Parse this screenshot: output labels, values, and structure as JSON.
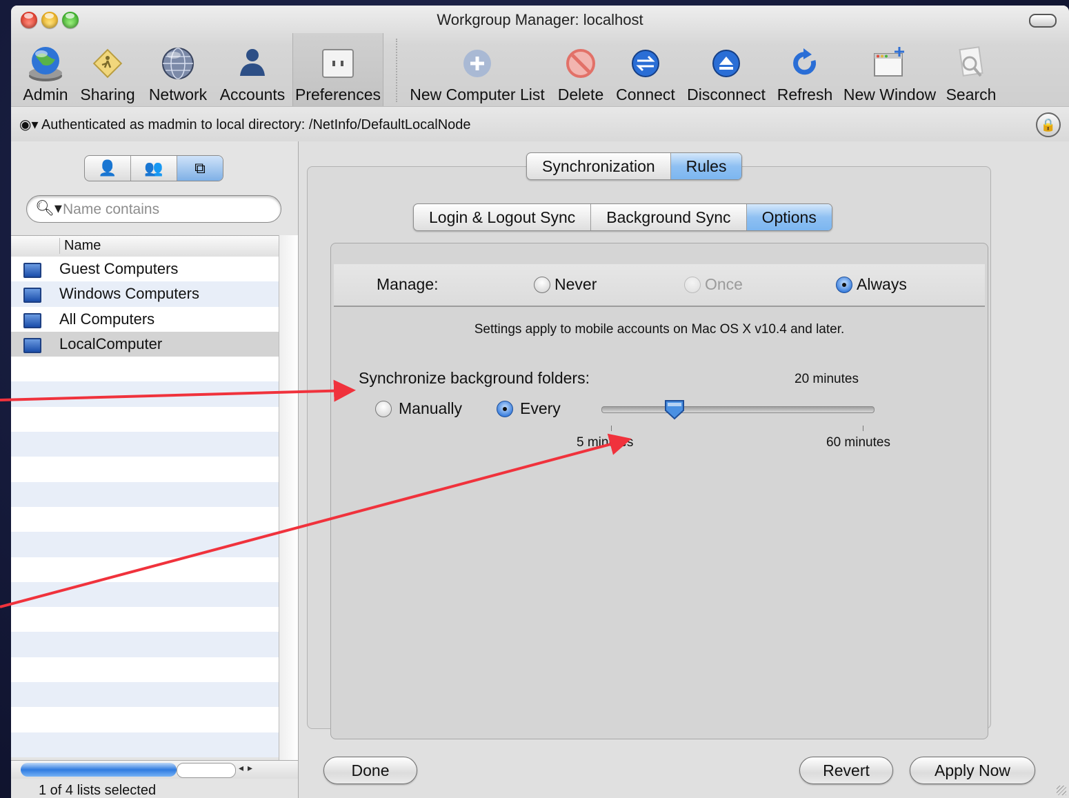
{
  "window": {
    "title": "Workgroup Manager: localhost"
  },
  "toolbar": {
    "items": [
      {
        "label": "Admin",
        "icon": "admin-globe-icon"
      },
      {
        "label": "Sharing",
        "icon": "sharing-sign-icon"
      },
      {
        "label": "Network",
        "icon": "network-globe-icon"
      },
      {
        "label": "Accounts",
        "icon": "accounts-person-icon"
      },
      {
        "label": "Preferences",
        "icon": "preferences-switch-icon"
      },
      {
        "label": "New Computer List",
        "icon": "plus-icon"
      },
      {
        "label": "Delete",
        "icon": "delete-icon"
      },
      {
        "label": "Connect",
        "icon": "connect-icon"
      },
      {
        "label": "Disconnect",
        "icon": "disconnect-icon"
      },
      {
        "label": "Refresh",
        "icon": "refresh-icon"
      },
      {
        "label": "New Window",
        "icon": "new-window-icon"
      },
      {
        "label": "Search",
        "icon": "search-icon"
      }
    ]
  },
  "pathbar": {
    "text": "Authenticated as madmin to local directory: /NetInfo/DefaultLocalNode"
  },
  "sidebar": {
    "search_placeholder": "Name contains",
    "column_header": "Name",
    "items": [
      "Guest Computers",
      "Windows Computers",
      "All Computers",
      "LocalComputer"
    ],
    "status": "1 of 4 lists selected"
  },
  "tabs_top": [
    "Synchronization",
    "Rules"
  ],
  "tabs_sub": [
    "Login & Logout Sync",
    "Background Sync",
    "Options"
  ],
  "manage": {
    "label": "Manage:",
    "options": [
      "Never",
      "Once",
      "Always"
    ],
    "selected": "Always"
  },
  "note": "Settings apply to mobile accounts on Mac OS X v10.4 and later.",
  "sync": {
    "label": "Synchronize background folders:",
    "current": "20 minutes",
    "manual_label": "Manually",
    "every_label": "Every",
    "min_label": "5 minutes",
    "max_label": "60 minutes",
    "value_fraction": 0.27
  },
  "buttons": {
    "done": "Done",
    "revert": "Revert",
    "apply": "Apply Now"
  },
  "colors": {
    "accent": "#3d86e8",
    "annotation_arrow": "#f0323c"
  }
}
